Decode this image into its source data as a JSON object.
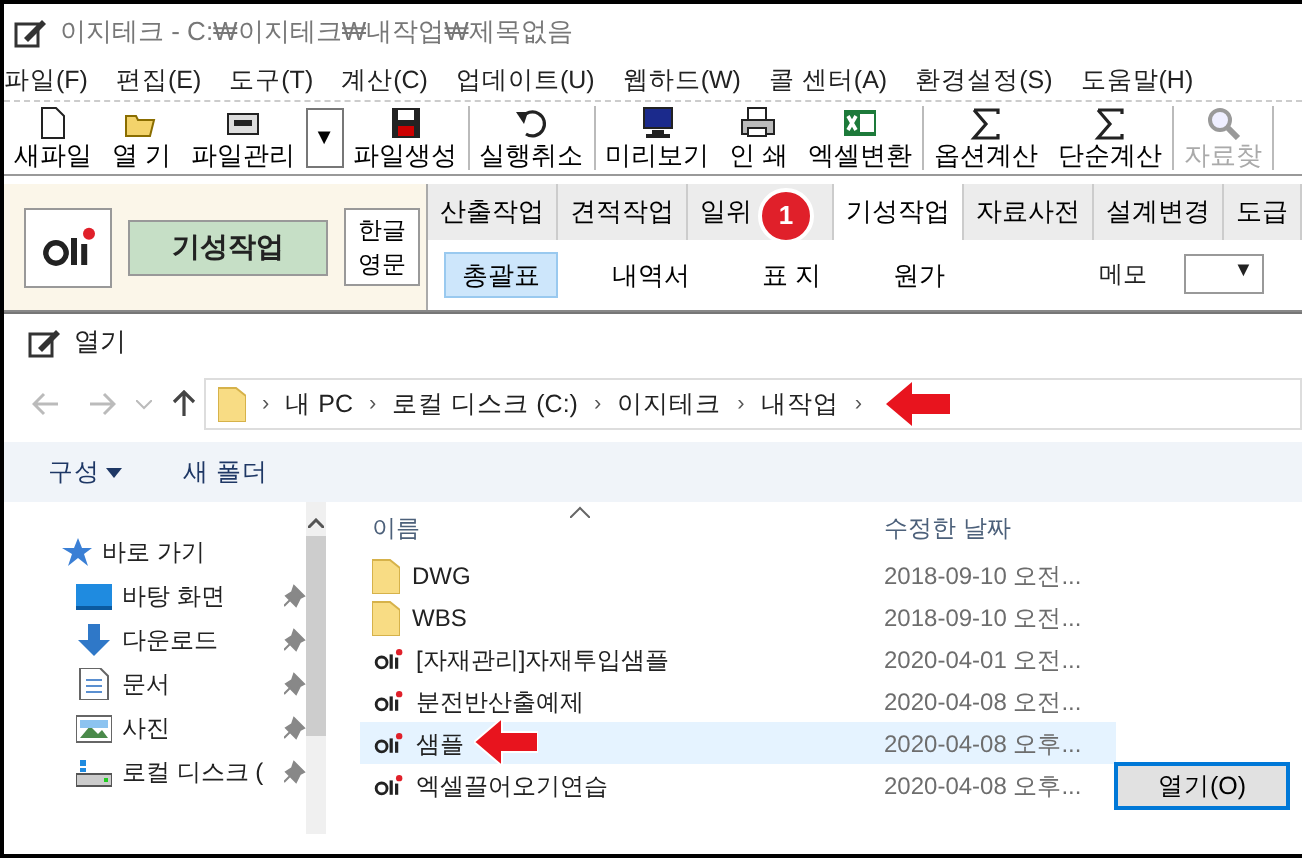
{
  "window": {
    "title": "이지테크 - C:₩이지테크₩내작업₩제목없음"
  },
  "menu": [
    "파일(F)",
    "편집(E)",
    "도구(T)",
    "계산(C)",
    "업데이트(U)",
    "웹하드(W)",
    "콜 센터(A)",
    "환경설정(S)",
    "도움말(H)"
  ],
  "toolbar": [
    [
      {
        "label": "새파일",
        "kind": "button",
        "disabled": false
      },
      {
        "label": "열 기",
        "kind": "button",
        "disabled": false
      },
      {
        "label": "파일관리",
        "kind": "button",
        "disabled": false
      },
      {
        "label": "▼",
        "kind": "dropdown",
        "disabled": false
      },
      {
        "label": "파일생성",
        "kind": "button",
        "disabled": false
      }
    ],
    [
      {
        "label": "실행취소",
        "kind": "button",
        "disabled": false
      }
    ],
    [
      {
        "label": "미리보기",
        "kind": "button",
        "disabled": false
      },
      {
        "label": "인 쇄",
        "kind": "button",
        "disabled": false
      },
      {
        "label": "엑셀변환",
        "kind": "button",
        "disabled": false
      }
    ],
    [
      {
        "label": "옵션계산",
        "kind": "button",
        "disabled": false
      },
      {
        "label": "단순계산",
        "kind": "button",
        "disabled": false
      }
    ],
    [
      {
        "label": "자료찾",
        "kind": "button",
        "disabled": true
      }
    ]
  ],
  "mode_panel": {
    "current": "기성작업",
    "language": [
      "한글",
      "영문"
    ]
  },
  "tabs": [
    {
      "label": "산출작업",
      "selected": false
    },
    {
      "label": "견적작업",
      "selected": false
    },
    {
      "label": "일위",
      "selected": false
    },
    {
      "label": "기성작업",
      "selected": true
    },
    {
      "label": "자료사전",
      "selected": false
    },
    {
      "label": "설계변경",
      "selected": false
    },
    {
      "label": "도급",
      "selected": false
    }
  ],
  "step_badge": "1",
  "subtabs": [
    {
      "label": "총괄표",
      "selected": true
    },
    {
      "label": "내역서",
      "selected": false
    },
    {
      "label": "표 지",
      "selected": false
    },
    {
      "label": "원가",
      "selected": false
    }
  ],
  "memo": {
    "label": "메모",
    "dropdown": "▼"
  },
  "dialog": {
    "title": "열기",
    "breadcrumb": [
      {
        "label": "›",
        "kind": "separator"
      },
      {
        "label": "내 PC",
        "kind": "item"
      },
      {
        "label": "›",
        "kind": "separator"
      },
      {
        "label": "로컬 디스크 (C:)",
        "kind": "item"
      },
      {
        "label": "›",
        "kind": "separator"
      },
      {
        "label": "이지테크",
        "kind": "item"
      },
      {
        "label": "›",
        "kind": "separator"
      },
      {
        "label": "내작업",
        "kind": "item"
      },
      {
        "label": "›",
        "kind": "separator"
      }
    ],
    "commands": [
      {
        "label": "구성",
        "dropdown": true
      },
      {
        "label": "새 폴더",
        "dropdown": false
      }
    ],
    "nav": [
      {
        "label": "바로 가기",
        "children": [
          {
            "label": "바탕 화면"
          },
          {
            "label": "다운로드"
          },
          {
            "label": "문서"
          },
          {
            "label": "사진"
          },
          {
            "label": "로컬 디스크 ("
          }
        ]
      }
    ],
    "columns": [
      "이름",
      "수정한 날짜"
    ],
    "files": [
      {
        "name": "DWG",
        "date": "2018-09-10 오전...",
        "kind": "folder",
        "selected": false
      },
      {
        "name": "WBS",
        "date": "2018-09-10 오전...",
        "kind": "folder",
        "selected": false
      },
      {
        "name": "[자재관리]자재투입샘플",
        "date": "2020-04-01 오전...",
        "kind": "file",
        "selected": false
      },
      {
        "name": "분전반산출예제",
        "date": "2020-04-08 오전...",
        "kind": "file",
        "selected": false
      },
      {
        "name": "샘플",
        "date": "2020-04-08 오후...",
        "kind": "file",
        "selected": true
      },
      {
        "name": "엑셀끌어오기연습",
        "date": "2020-04-08 오후...",
        "kind": "file",
        "selected": false
      }
    ],
    "open_button": "열기(O)"
  }
}
